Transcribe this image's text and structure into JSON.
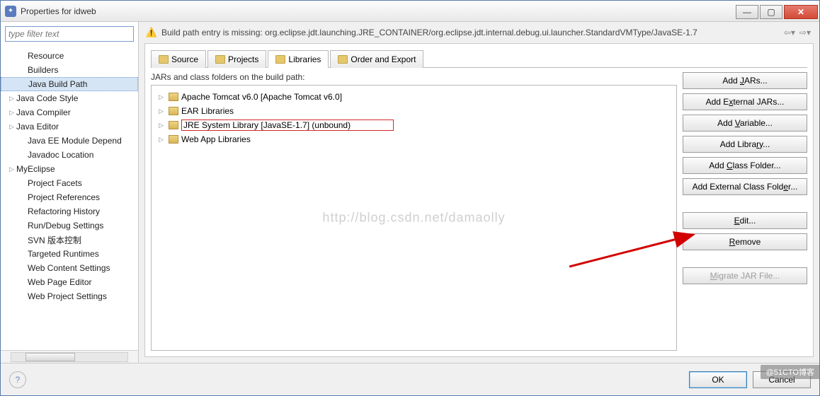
{
  "window": {
    "title": "Properties for idweb"
  },
  "filter": {
    "placeholder": "type filter text"
  },
  "sidebar": {
    "items": [
      {
        "label": "Resource",
        "child": true
      },
      {
        "label": "Builders",
        "child": true
      },
      {
        "label": "Java Build Path",
        "child": true,
        "selected": true
      },
      {
        "label": "Java Code Style",
        "arrow": true
      },
      {
        "label": "Java Compiler",
        "arrow": true
      },
      {
        "label": "Java Editor",
        "arrow": true
      },
      {
        "label": "Java EE Module Depend",
        "child": true
      },
      {
        "label": "Javadoc Location",
        "child": true
      },
      {
        "label": "MyEclipse",
        "arrow": true
      },
      {
        "label": "Project Facets",
        "child": true
      },
      {
        "label": "Project References",
        "child": true
      },
      {
        "label": "Refactoring History",
        "child": true
      },
      {
        "label": "Run/Debug Settings",
        "child": true
      },
      {
        "label": "SVN 版本控制",
        "child": true
      },
      {
        "label": "Targeted Runtimes",
        "child": true
      },
      {
        "label": "Web Content Settings",
        "child": true
      },
      {
        "label": "Web Page Editor",
        "child": true
      },
      {
        "label": "Web Project Settings",
        "child": true
      }
    ]
  },
  "warning": {
    "text": "Build path entry is missing: org.eclipse.jdt.launching.JRE_CONTAINER/org.eclipse.jdt.internal.debug.ui.launcher.StandardVMType/JavaSE-1.7"
  },
  "tabs": {
    "items": [
      {
        "label": "Source"
      },
      {
        "label": "Projects"
      },
      {
        "label": "Libraries",
        "active": true
      },
      {
        "label": "Order and Export"
      }
    ]
  },
  "tree": {
    "label": "JARs and class folders on the build path:",
    "nodes": [
      {
        "label": "Apache Tomcat v6.0 [Apache Tomcat v6.0]"
      },
      {
        "label": "EAR Libraries"
      },
      {
        "label": "JRE System Library [JavaSE-1.7] (unbound)",
        "selected": true
      },
      {
        "label": "Web App Libraries"
      }
    ],
    "watermark": "http://blog.csdn.net/damaolly"
  },
  "buttons": {
    "add_jars": "Add JARs...",
    "add_ext_jars": "Add External JARs...",
    "add_variable": "Add Variable...",
    "add_library": "Add Library...",
    "add_class_folder": "Add Class Folder...",
    "add_ext_class_folder": "Add External Class Folder...",
    "edit": "Edit...",
    "remove": "Remove",
    "migrate": "Migrate JAR File..."
  },
  "footer": {
    "ok": "OK",
    "cancel": "Cancel"
  },
  "badge": "@51CTO博客"
}
